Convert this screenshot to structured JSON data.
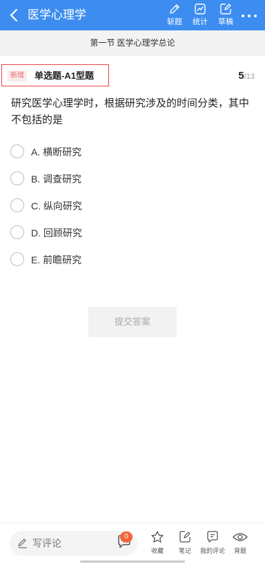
{
  "header": {
    "title": "医学心理学",
    "actions": [
      {
        "label": "斩题",
        "icon": "pencil-icon"
      },
      {
        "label": "统计",
        "icon": "chart-icon"
      },
      {
        "label": "草稿",
        "icon": "edit-square-icon"
      }
    ],
    "more_icon": "more-dots-icon"
  },
  "section": {
    "title": "第一节 医学心理学总论"
  },
  "question_type": {
    "badge": "新增",
    "label": "单选题-A1型题"
  },
  "counter": {
    "current": "5",
    "total": "/13"
  },
  "question": {
    "text": "研究医学心理学时，根据研究涉及的时间分类，其中不包括的是"
  },
  "options": [
    {
      "label": "A. 横断研究"
    },
    {
      "label": "B. 调查研究"
    },
    {
      "label": "C. 纵向研究"
    },
    {
      "label": "D. 回顾研究"
    },
    {
      "label": "E. 前瞻研究"
    }
  ],
  "submit": {
    "label": "提交答案"
  },
  "bottom_bar": {
    "comment_placeholder": "写评论",
    "comment_count": "0",
    "actions": [
      {
        "label": "收藏",
        "icon": "star-icon"
      },
      {
        "label": "笔记",
        "icon": "note-icon"
      },
      {
        "label": "我的评论",
        "icon": "comment-list-icon"
      },
      {
        "label": "背题",
        "icon": "eye-icon"
      }
    ]
  },
  "colors": {
    "header_bg": "#3d8df0",
    "accent_red": "#e84444",
    "badge_orange": "#f0663a"
  }
}
